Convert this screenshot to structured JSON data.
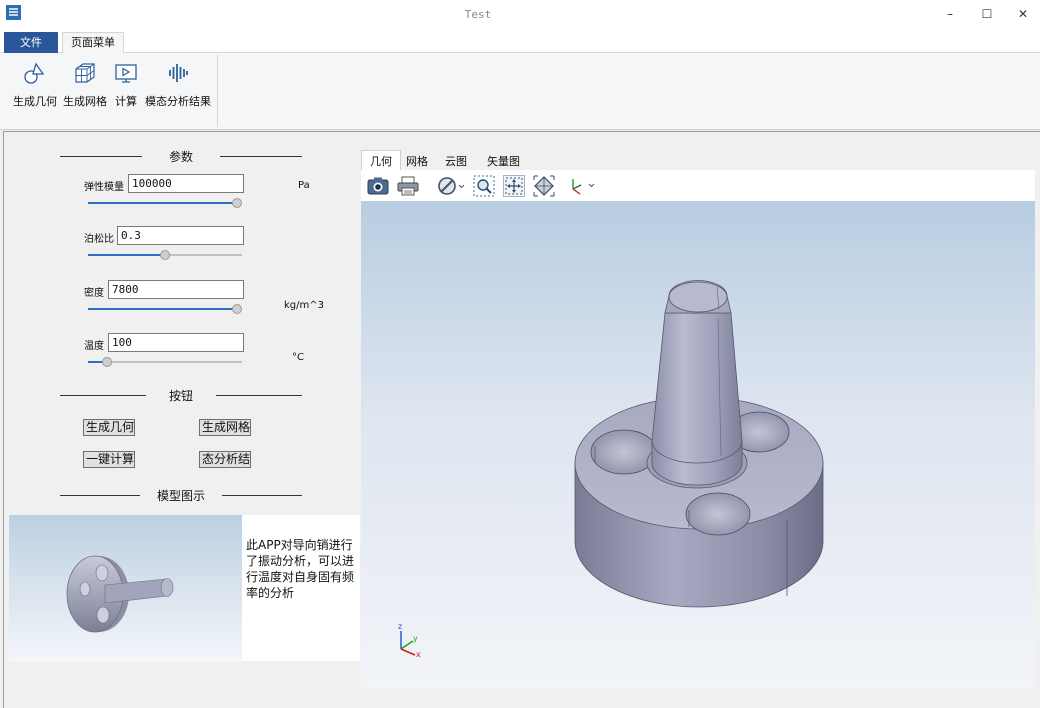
{
  "window": {
    "title": "Test",
    "controls": {
      "minimize": "–",
      "maximize": "☐",
      "close": "✕"
    }
  },
  "ribbon": {
    "tabs": [
      {
        "label": "文件"
      },
      {
        "label": "页面菜单"
      }
    ],
    "buttons": [
      {
        "label": "生成几何",
        "icon": "geometry-shapes-icon"
      },
      {
        "label": "生成网格",
        "icon": "mesh-cube-icon"
      },
      {
        "label": "计算",
        "icon": "compute-play-icon"
      },
      {
        "label": "模态分析结果",
        "icon": "waveform-icon"
      }
    ]
  },
  "params": {
    "section_title": "参数",
    "fields": [
      {
        "label": "弹性模量",
        "value": "100000",
        "unit": "Pa",
        "slider": 1.0
      },
      {
        "label": "泊松比",
        "value": "0.3",
        "unit": "",
        "slider": 0.5
      },
      {
        "label": "密度",
        "value": "7800",
        "unit": "kg/m^3",
        "slider": 1.0
      },
      {
        "label": "温度",
        "value": "100",
        "unit": "°C",
        "slider": 0.1
      }
    ]
  },
  "buttons_section": {
    "title": "按钮",
    "buttons": [
      {
        "label": "生成几何"
      },
      {
        "label": "生成网格"
      },
      {
        "label": "一键计算"
      },
      {
        "label": "态分析结"
      }
    ]
  },
  "model_section": {
    "title": "模型图示",
    "description": "此APP对导向销进行了振动分析，可以进行温度对自身固有频率的分析"
  },
  "view": {
    "tabs": [
      {
        "label": "几何"
      },
      {
        "label": "网格"
      },
      {
        "label": "云图"
      },
      {
        "label": "矢量图"
      }
    ],
    "active_tab": "几何",
    "toolbar": [
      "camera-icon",
      "print-icon",
      "hide-icon",
      "zoom-box-icon",
      "zoom-extents-icon",
      "fit-view-icon",
      "axes-icon"
    ],
    "axes": {
      "x": "x",
      "y": "y",
      "z": "z"
    }
  },
  "colors": {
    "accent": "#2b579a",
    "slider": "#2f6fc4",
    "part": "#a7a9c4"
  }
}
